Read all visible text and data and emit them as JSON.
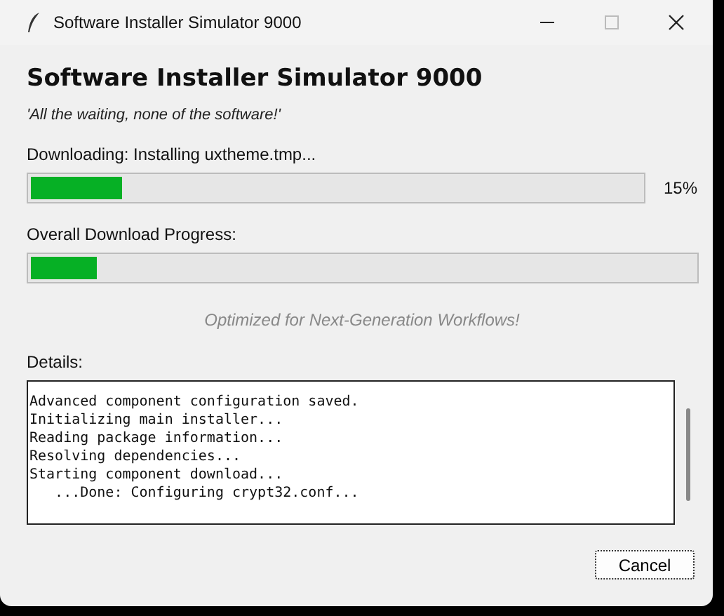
{
  "window": {
    "title": "Software Installer Simulator 9000"
  },
  "heading": "Software Installer Simulator 9000",
  "tagline": "'All the waiting, none of the software!'",
  "current": {
    "label": "Downloading: Installing uxtheme.tmp...",
    "level": 0.15,
    "percent": "15%"
  },
  "overall": {
    "label": "Overall Download Progress:",
    "level": 0.1
  },
  "slogan": "Optimized for Next-Generation Workflows!",
  "details": {
    "label": "Details:",
    "lines": [
      "Advanced component configuration saved.",
      "Initializing main installer...",
      "Reading package information...",
      "Resolving dependencies...",
      "Starting component download...",
      "   ...Done: Configuring crypt32.conf..."
    ]
  },
  "buttons": [
    "Cancel"
  ]
}
